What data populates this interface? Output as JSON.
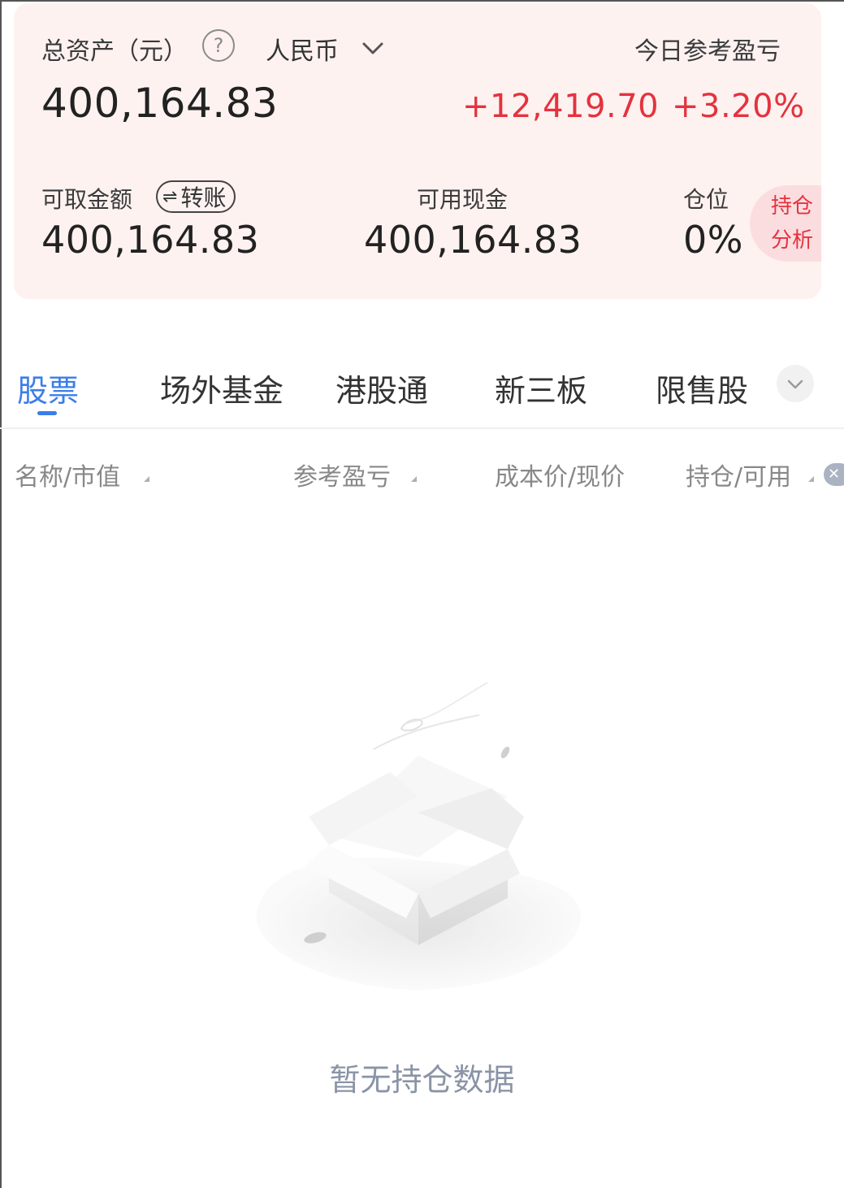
{
  "asset_card": {
    "total_assets_label": "总资产（元）",
    "currency": "人民币",
    "total_assets_value": "400,164.83",
    "today_pnl_label": "今日参考盈亏",
    "today_pnl_amount": "+12,419.70",
    "today_pnl_percent": "+3.20%",
    "withdrawable_label": "可取金额",
    "transfer_label": "转账",
    "withdrawable_value": "400,164.83",
    "available_cash_label": "可用现金",
    "available_cash_value": "400,164.83",
    "position_label": "仓位",
    "position_value": "0%",
    "analysis_line1": "持仓",
    "analysis_line2": "分析"
  },
  "tabs": [
    {
      "label": "股票",
      "active": true
    },
    {
      "label": "场外基金",
      "active": false
    },
    {
      "label": "港股通",
      "active": false
    },
    {
      "label": "新三板",
      "active": false
    },
    {
      "label": "限售股",
      "active": false
    }
  ],
  "columns": [
    {
      "label": "名称/市值",
      "sortable": true
    },
    {
      "label": "参考盈亏",
      "sortable": true
    },
    {
      "label": "成本价/现价",
      "sortable": false
    },
    {
      "label": "持仓/可用",
      "sortable": true
    }
  ],
  "empty_state": {
    "message": "暂无持仓数据",
    "icon": "empty-box-icon"
  },
  "colors": {
    "accent": "#3b7de9",
    "profit": "#e5323e",
    "card_bg": "#fdf2f0"
  }
}
